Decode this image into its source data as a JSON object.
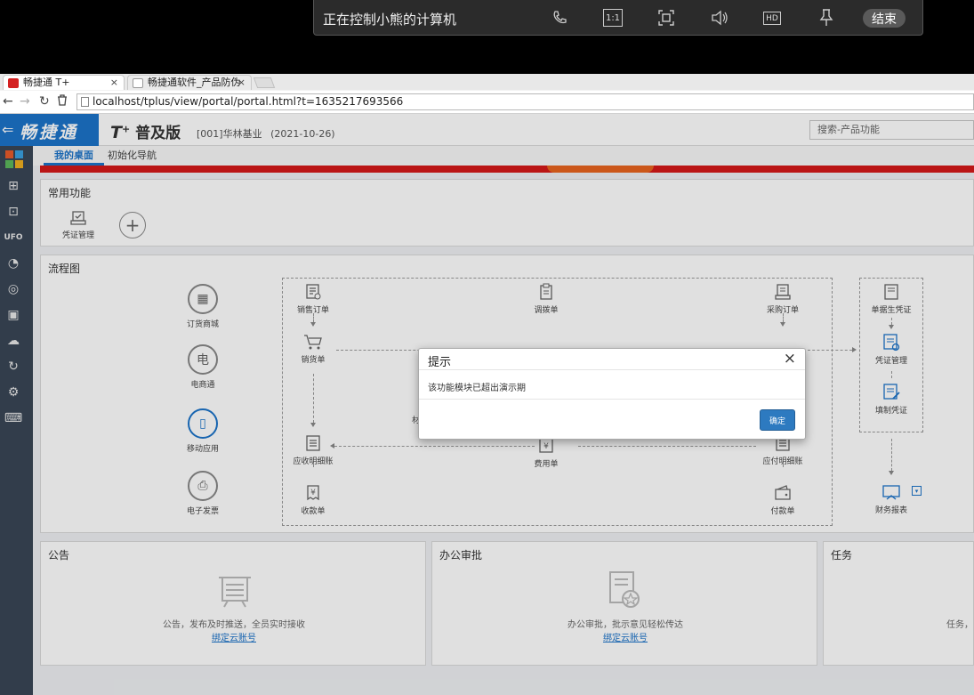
{
  "remote_bar": {
    "title": "正在控制小熊的计算机",
    "end_label": "结束",
    "icons": [
      "phone-icon",
      "actual-size-icon",
      "fit-screen-icon",
      "volume-icon",
      "hd-icon",
      "pin-icon"
    ],
    "ratio_label": "1:1",
    "hd_label": "HD"
  },
  "browser": {
    "tabs": [
      {
        "label": "畅捷通 T+",
        "active": true
      },
      {
        "label": "畅捷通软件_产品防伪",
        "active": false
      }
    ],
    "url": "localhost/tplus/view/portal/portal.html?t=1635217693566"
  },
  "header": {
    "brand": "畅捷通",
    "product_mark": "T",
    "product_plus": "+",
    "edition": "普及版",
    "org": "[001]华林基业",
    "date": "(2021-10-26)",
    "search_placeholder": "搜索-产品功能"
  },
  "subtabs": [
    "我的桌面",
    "初始化导航"
  ],
  "quick": {
    "title": "常用功能",
    "items": [
      {
        "label": "凭证管理"
      }
    ],
    "add_symbol": "+"
  },
  "flow": {
    "title": "流程图",
    "side_nodes": [
      "订货商城",
      "电商通",
      "移动应用",
      "电子发票"
    ],
    "side_glyphs": [
      "▦",
      "电",
      "▯",
      "⎙"
    ],
    "nodes": {
      "sales_order": "销售订单",
      "delivery": "销货单",
      "receivable": "应收明细账",
      "receipt": "收款单",
      "transfer": "调拨单",
      "expense": "费用单",
      "purchase_order": "采购订单",
      "payable": "应付明细账",
      "payment": "付款单",
      "gen_voucher": "单据生凭证",
      "voucher_mgmt": "凭证管理",
      "fill_voucher": "填制凭证",
      "fin_report": "财务报表",
      "partial_left": "材"
    }
  },
  "panels": {
    "notice": {
      "title": "公告",
      "text": "公告，发布及时推送，全员实时接收",
      "link": "绑定云账号"
    },
    "approval": {
      "title": "办公审批",
      "text": "办公审批，批示意见轻松传达",
      "link": "绑定云账号"
    },
    "task": {
      "title": "任务",
      "text": "任务，"
    }
  },
  "modal": {
    "title": "提示",
    "message": "该功能模块已超出演示期",
    "ok_label": "确定",
    "close_symbol": "×"
  },
  "colors": {
    "brand_blue": "#1c73c9",
    "banner_red": "#d41818",
    "sidebar": "#3a4656"
  }
}
